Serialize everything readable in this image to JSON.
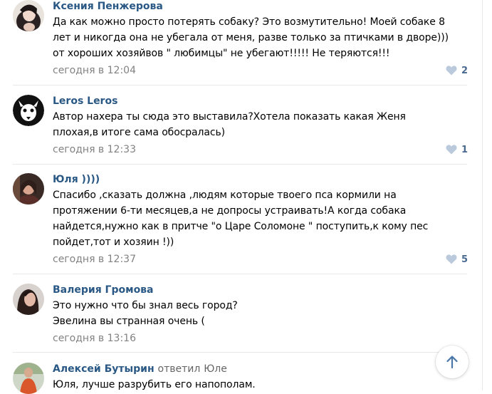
{
  "comments": [
    {
      "author": "Ксения Пенжерова",
      "text": "Да как можно просто потерять собаку? Это возмутительно! Моей собаке 8\nлет и никогда она не убегала от меня, разве только за птичками в дворе)))\nот хороших хозяйвов \" любимцы\" не убегают!!!!! Не теряются!!!",
      "time": "сегодня в 12:04",
      "likes": "2"
    },
    {
      "author": "Leros Leros",
      "text": "Автор нахера ты сюда это выставила?Хотела показать какая Женя\nплохая,в итоге сама обосралась)",
      "time": "сегодня в 12:33",
      "likes": "1"
    },
    {
      "author": "Юля ))))",
      "text": "Спасибо ,сказать должна ,людям которые твоего пса кормили на\nпротяжении 6-ти месяцев,а не допросы устраивать!А когда собака\nнайдется,нужно как в притче \"о Царе Соломоне \" поступить,к кому пес\nпойдет,тот и хозяин !))",
      "time": "сегодня в 12:37",
      "likes": "5"
    },
    {
      "author": "Валерия Громова",
      "text": "Это нужно что бы знал весь город?\nЭвелина вы странная очень (",
      "time": "сегодня в 13:16"
    },
    {
      "author": "Алексей Бутырин",
      "replied_label": "ответил",
      "replied_to": "Юле",
      "text": "Юля, лучше разрубить его напополам."
    }
  ],
  "colors": {
    "author": "#2a5885",
    "meta": "#828282",
    "like_heart": "#bac9db",
    "like_count": "#4a6a8f",
    "separator": "#e7e8ec"
  },
  "icons": {
    "like": "heart-icon",
    "scroll_top": "arrow-up-icon"
  }
}
